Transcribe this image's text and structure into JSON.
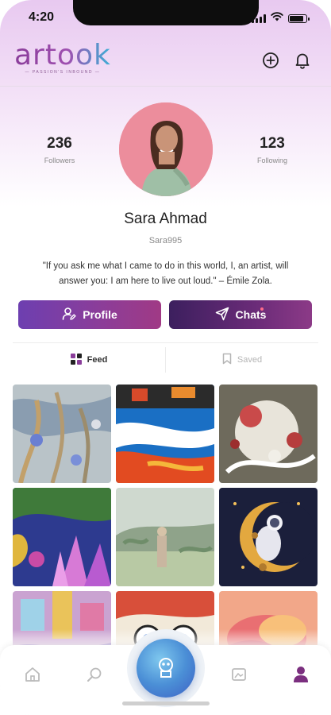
{
  "status_bar": {
    "time": "4:20",
    "battery_level": 0.85,
    "signal_bars": 4
  },
  "header": {
    "logo_text": "artook",
    "logo_tagline": "— PASSION'S INBOUND —",
    "add_icon": "plus-circle-icon",
    "notification_icon": "bell-icon"
  },
  "profile": {
    "followers_count": "236",
    "followers_label": "Followers",
    "following_count": "123",
    "following_label": "Following",
    "name": "Sara Ahmad",
    "username": "Sara995",
    "quote": "\"If you ask me what I came to do in this world, I, an artist, will answer you: I am here to live out loud.\" – Émile Zola."
  },
  "actions": {
    "profile_label": "Profile",
    "chats_label": "Chats",
    "chats_has_unread": true
  },
  "tabs": {
    "feed_label": "Feed",
    "saved_label": "Saved",
    "active": "Feed"
  },
  "feed_tiles": [
    "abstract-blue-grey-painting",
    "blue-orange-abstract-painting",
    "red-white-abstract-painting",
    "purple-lotus-painting",
    "landscape-woman-painting",
    "astronaut-moon-illustration",
    "graffiti-city-painting",
    "cartoon-face-mural",
    "pink-cloud-painting"
  ],
  "bottom_nav": {
    "items": [
      "home-icon",
      "search-icon",
      "brand-center-icon",
      "gallery-icon",
      "profile-icon"
    ],
    "active": "profile-icon"
  },
  "colors": {
    "brand_purple": "#8a3d9a",
    "brand_blue": "#3bb0d6",
    "chat_dot": "#ff6b8a"
  }
}
